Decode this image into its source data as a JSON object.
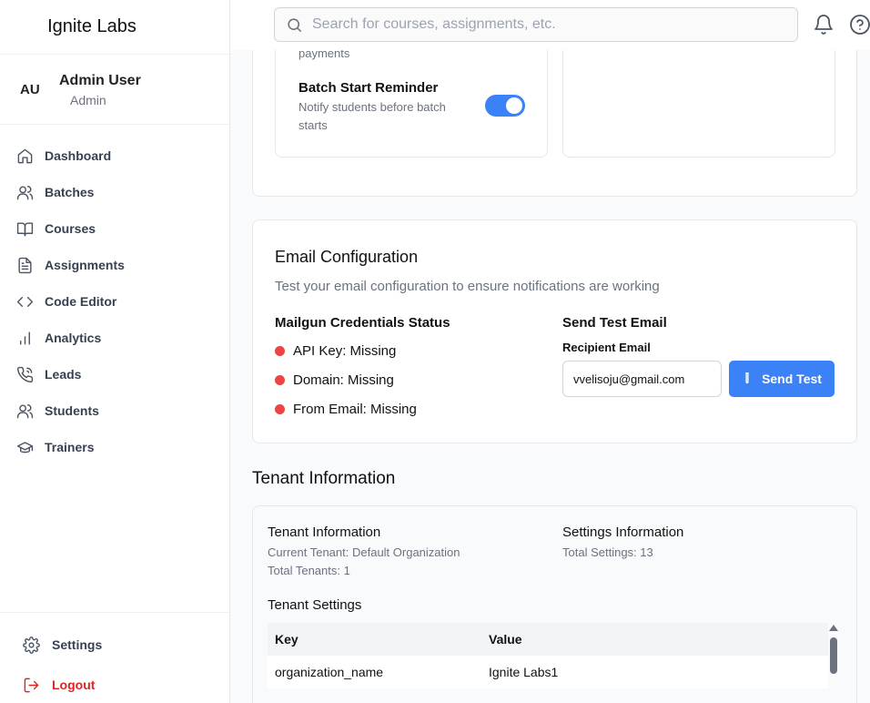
{
  "brand": "Ignite Labs",
  "profile": {
    "initials": "AU",
    "name": "Admin User",
    "role": "Admin"
  },
  "nav": [
    {
      "label": "Dashboard",
      "icon": "home-icon"
    },
    {
      "label": "Batches",
      "icon": "users-icon"
    },
    {
      "label": "Courses",
      "icon": "book-icon"
    },
    {
      "label": "Assignments",
      "icon": "file-text-icon"
    },
    {
      "label": "Code Editor",
      "icon": "code-icon"
    },
    {
      "label": "Analytics",
      "icon": "bar-chart-icon"
    },
    {
      "label": "Leads",
      "icon": "phone-icon"
    },
    {
      "label": "Students",
      "icon": "users-icon"
    },
    {
      "label": "Trainers",
      "icon": "graduation-cap-icon"
    }
  ],
  "bottom_nav": {
    "settings": "Settings",
    "logout": "Logout"
  },
  "header": {
    "search_placeholder": "Search for courses, assignments, etc."
  },
  "notifications": {
    "cut_desc": "Send reminders for upcoming payments",
    "batch_start_title": "Batch Start Reminder",
    "batch_start_desc": "Notify students before batch starts",
    "payment_reminder_enabled": true,
    "batch_start_enabled": true
  },
  "email_config": {
    "title": "Email Configuration",
    "subtitle": "Test your email configuration to ensure notifications are working",
    "mailgun_title": "Mailgun Credentials Status",
    "statuses": [
      "API Key: Missing",
      "Domain: Missing",
      "From Email: Missing"
    ],
    "send_title": "Send Test Email",
    "recipient_label": "Recipient Email",
    "recipient_value": "vvelisoju@gmail.com",
    "send_button": "Send Test",
    "status_color": "#ef4444",
    "accent_color": "#3b82f6"
  },
  "tenant": {
    "heading": "Tenant Information",
    "info_title": "Tenant Information",
    "current_tenant": "Current Tenant: Default Organization",
    "total_tenants": "Total Tenants: 1",
    "settings_title": "Settings Information",
    "total_settings": "Total Settings: 13",
    "table_title": "Tenant Settings",
    "columns": [
      "Key",
      "Value"
    ],
    "rows": [
      {
        "key": "organization_name",
        "value": "Ignite Labs1"
      }
    ]
  }
}
